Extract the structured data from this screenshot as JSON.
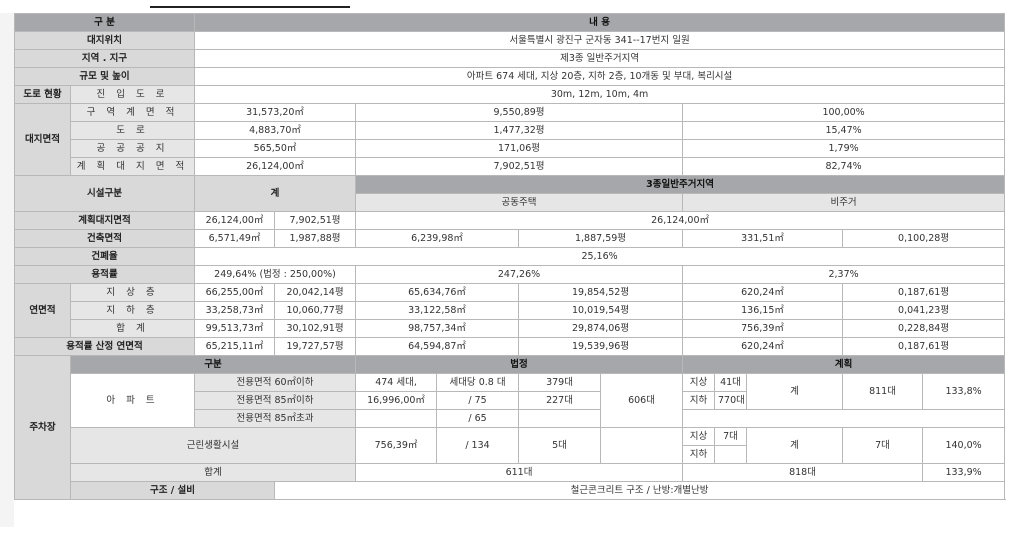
{
  "header": {
    "col1": "구 분",
    "col2": "내 용"
  },
  "info": {
    "location_label": "대지위치",
    "location_value": "서울특별시 광진구 군자동 341--17번지 일원",
    "zone_label": "지역 . 지구",
    "zone_value": "제3종 일반주거지역",
    "scale_label": "규모 및 높이",
    "scale_value": "아파트 674 세대, 지상 20층, 지하 2층, 10개동 및 부대, 복리시설",
    "road_label": "도로 현황",
    "road_sub": "진 입 도 로",
    "road_value": "30m, 12m, 10m, 4m"
  },
  "site_area": {
    "label": "대지면적",
    "rows": [
      {
        "name": "구 역 계 면 적",
        "m2": "31,573,20㎡",
        "py": "9,550,89평",
        "pct": "100,00%"
      },
      {
        "name": "도 로",
        "m2": "4,883,70㎡",
        "py": "1,477,32평",
        "pct": "15,47%"
      },
      {
        "name": "공 공 공 지",
        "m2": "565,50㎡",
        "py": "171,06평",
        "pct": "1,79%"
      },
      {
        "name": "계 획 대 지 면 적",
        "m2": "26,124,00㎡",
        "py": "7,902,51평",
        "pct": "82,74%"
      }
    ]
  },
  "facility": {
    "label": "시설구분",
    "total_label": "계",
    "zone_label": "3종일반주거지역",
    "housing_label": "공동주택",
    "nonres_label": "비주거",
    "plan_site_label": "계획대지면적",
    "plan_site_m2": "26,124,00㎡",
    "plan_site_py": "7,902,51평",
    "plan_site_zone": "26,124,00㎡",
    "bldg_label": "건축면적",
    "bldg_m2": "6,571,49㎡",
    "bldg_py": "1,987,88평",
    "bldg_house_m2": "6,239,98㎡",
    "bldg_house_py": "1,887,59평",
    "bldg_non_m2": "331,51㎡",
    "bldg_non_py": "0,100,28평",
    "cov_label": "건폐율",
    "cov_value": "25,16%",
    "far_label": "용적률",
    "far_total": "249,64% (법정 : 250,00%)",
    "far_house": "247,26%",
    "far_non": "2,37%",
    "floor_label": "연면적",
    "floors": [
      {
        "name": "지 상 층",
        "m2": "66,255,00㎡",
        "py": "20,042,14평",
        "h_m2": "65,634,76㎡",
        "h_py": "19,854,52평",
        "n_m2": "620,24㎡",
        "n_py": "0,187,61평"
      },
      {
        "name": "지 하 층",
        "m2": "33,258,73㎡",
        "py": "10,060,77평",
        "h_m2": "33,122,58㎡",
        "h_py": "10,019,54평",
        "n_m2": "136,15㎡",
        "n_py": "0,041,23평"
      },
      {
        "name": "합 계",
        "m2": "99,513,73㎡",
        "py": "30,102,91평",
        "h_m2": "98,757,34㎡",
        "h_py": "29,874,06평",
        "n_m2": "756,39㎡",
        "n_py": "0,228,84평"
      }
    ],
    "farcalc_label": "용적률 산정 연면적",
    "farcalc_m2": "65,215,11㎡",
    "farcalc_py": "19,727,57평",
    "farcalc_h_m2": "64,594,87㎡",
    "farcalc_h_py": "19,539,96평",
    "farcalc_n_m2": "620,24㎡",
    "farcalc_n_py": "0,187,61평"
  },
  "parking": {
    "label": "주차장",
    "col_div": "구분",
    "col_legal": "법정",
    "col_plan": "계획",
    "apt_label": "아 파 트",
    "apt_rows": [
      {
        "name": "전용면적 60㎡이하",
        "a": "474 세대,",
        "b": "세대당 0.8 대",
        "c": "379대"
      },
      {
        "name": "전용면적 85㎡이하",
        "a": "16,996,00㎡",
        "b": "/ 75",
        "c": "227대"
      },
      {
        "name": "전용면적 85㎡초과",
        "a": "",
        "b": "/ 65",
        "c": ""
      }
    ],
    "apt_legal_total": "606대",
    "above": "지상",
    "below": "지하",
    "apt_above": "41대",
    "apt_below": "770대",
    "sum_word": "계",
    "apt_plan": "811대",
    "apt_pct": "133,8%",
    "retail_label": "근린생활시설",
    "retail_a": "756,39㎡",
    "retail_b": "/ 134",
    "retail_c": "5대",
    "retail_above": "7대",
    "retail_plan": "7대",
    "retail_pct": "140,0%",
    "total_label": "합계",
    "total_legal": "611대",
    "total_plan": "818대",
    "total_pct": "133,9%"
  },
  "structure": {
    "label": "구조 / 설비",
    "value": "철근콘크리트 구조 / 난방:개별난방"
  }
}
